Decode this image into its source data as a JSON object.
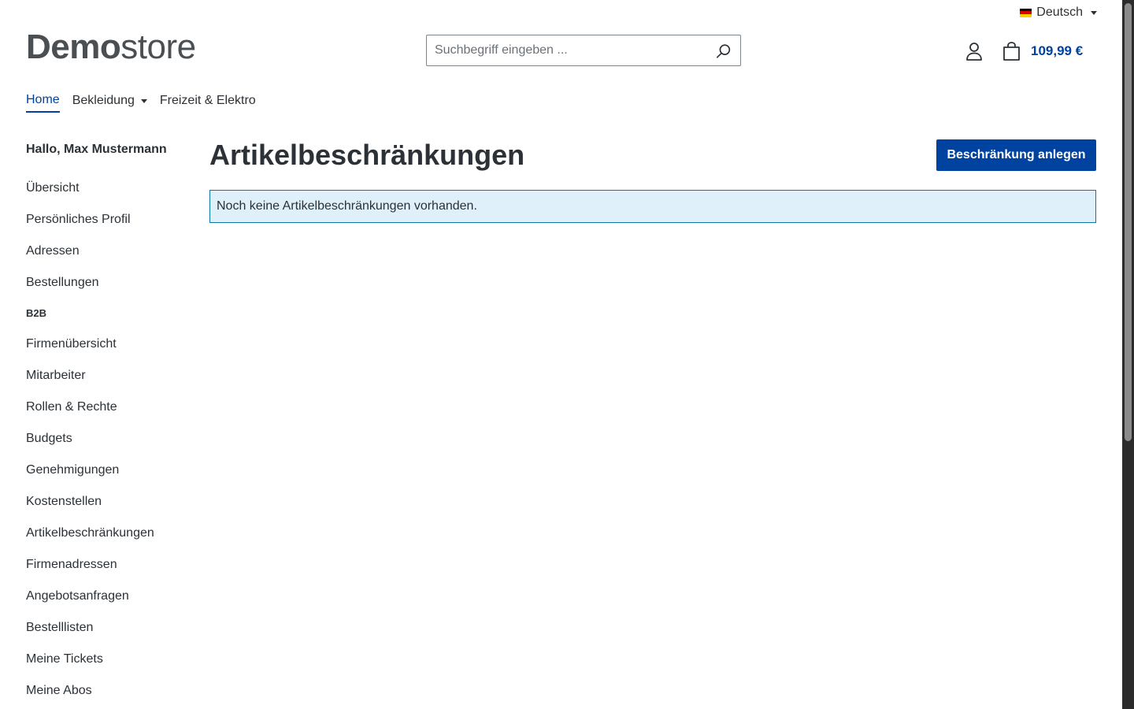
{
  "language": {
    "label": "Deutsch",
    "flag_colors": [
      "#000000",
      "#dd0000",
      "#ffce00"
    ]
  },
  "header": {
    "logo_bold": "Demo",
    "logo_light": "store",
    "search_placeholder": "Suchbegriff eingeben ...",
    "cart_total": "109,99 €"
  },
  "mainnav": {
    "items": [
      {
        "label": "Home",
        "active": true
      },
      {
        "label": "Bekleidung",
        "dropdown": true
      },
      {
        "label": "Freizeit & Elektro"
      }
    ]
  },
  "sidebar": {
    "greeting": "Hallo, Max Mustermann",
    "items": [
      {
        "label": "Übersicht"
      },
      {
        "label": "Persönliches Profil"
      },
      {
        "label": "Adressen"
      },
      {
        "label": "Bestellungen"
      },
      {
        "label": "B2B",
        "section": true
      },
      {
        "label": "Firmenübersicht"
      },
      {
        "label": "Mitarbeiter"
      },
      {
        "label": "Rollen & Rechte"
      },
      {
        "label": "Budgets"
      },
      {
        "label": "Genehmigungen"
      },
      {
        "label": "Kostenstellen"
      },
      {
        "label": "Artikelbeschränkungen"
      },
      {
        "label": "Firmenadressen"
      },
      {
        "label": "Angebotsanfragen"
      },
      {
        "label": "Bestelllisten"
      },
      {
        "label": "Meine Tickets"
      },
      {
        "label": "Meine Abos"
      }
    ]
  },
  "content": {
    "title": "Artikelbeschränkungen",
    "create_button": "Beschränkung anlegen",
    "empty_message": "Noch keine Artikelbeschränkungen vorhanden."
  },
  "colors": {
    "primary": "#0042a0",
    "text": "#2b3136",
    "info_bg": "#dff0fb",
    "info_border": "#0b78a8"
  }
}
